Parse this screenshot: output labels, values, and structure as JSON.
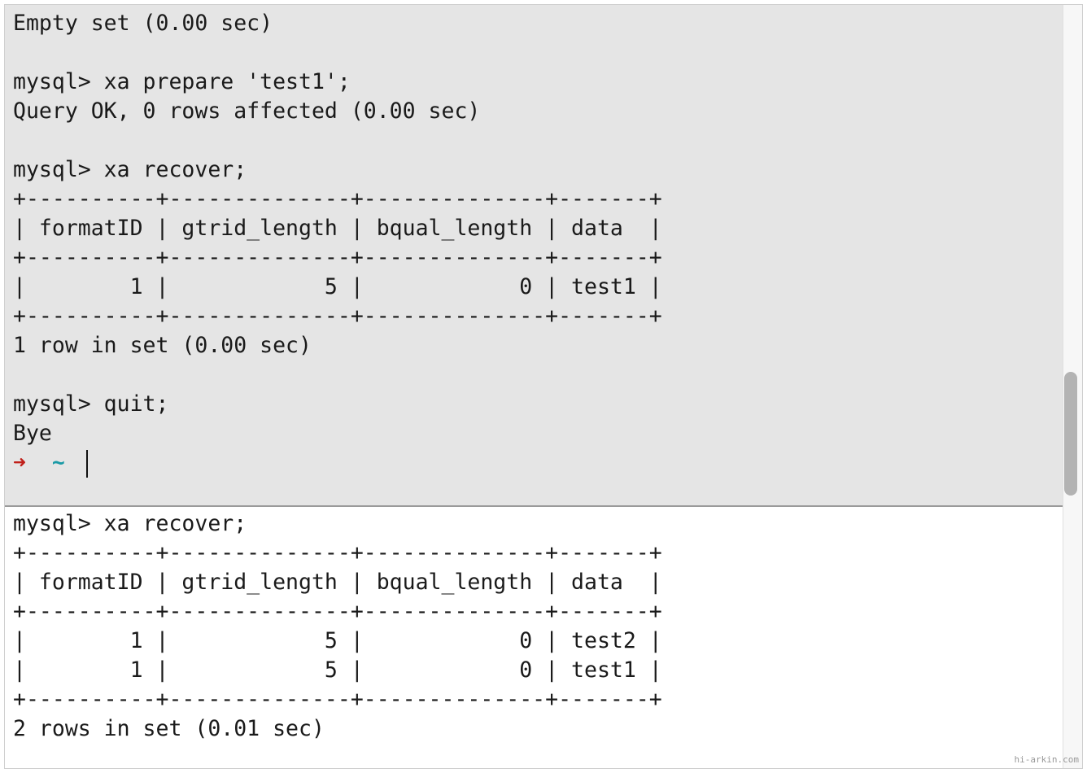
{
  "top_pane": {
    "lines": [
      "Empty set (0.00 sec)",
      "",
      "mysql> xa prepare 'test1';",
      "Query OK, 0 rows affected (0.00 sec)",
      "",
      "mysql> xa recover;",
      "+----------+--------------+--------------+-------+",
      "| formatID | gtrid_length | bqual_length | data  |",
      "+----------+--------------+--------------+-------+",
      "|        1 |            5 |            0 | test1 |",
      "+----------+--------------+--------------+-------+",
      "1 row in set (0.00 sec)",
      "",
      "mysql> quit;",
      "Bye"
    ],
    "prompt": {
      "arrow": "➜",
      "dir": "~"
    }
  },
  "bottom_pane": {
    "lines": [
      "mysql> xa recover;",
      "+----------+--------------+--------------+-------+",
      "| formatID | gtrid_length | bqual_length | data  |",
      "+----------+--------------+--------------+-------+",
      "|        1 |            5 |            0 | test2 |",
      "|        1 |            5 |            0 | test1 |",
      "+----------+--------------+--------------+-------+",
      "2 rows in set (0.01 sec)"
    ]
  },
  "watermark": "hi-arkin.com",
  "colors": {
    "prompt_arrow": "#c0201a",
    "prompt_dir": "#1a9aa6",
    "inactive_pane_bg": "#e5e5e5"
  }
}
